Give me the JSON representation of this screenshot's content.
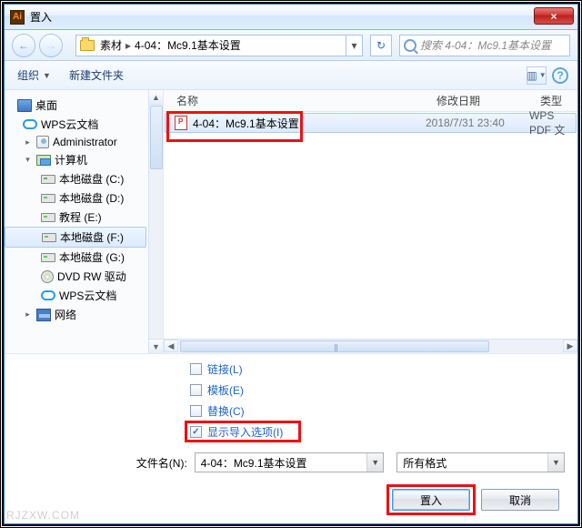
{
  "window": {
    "title": "置入",
    "close": "×"
  },
  "nav": {
    "path_segments": [
      "素材",
      "4-04：Mc9.1基本设置"
    ],
    "search_placeholder": "搜索 4-04：Mc9.1基本设置",
    "back_glyph": "←",
    "fwd_glyph": "→",
    "refresh_glyph": "↻",
    "sep": "▸",
    "drop": "▾"
  },
  "toolbar": {
    "organize": "组织",
    "newfolder": "新建文件夹",
    "drop": "▼",
    "view_glyph": "▥",
    "help": "?"
  },
  "tree": {
    "desktop": "桌面",
    "wps": "WPS云文档",
    "admin": "Administrator",
    "computer": "计算机",
    "drive_c": "本地磁盘 (C:)",
    "drive_d": "本地磁盘 (D:)",
    "drive_e": "教程 (E:)",
    "drive_f": "本地磁盘 (F:)",
    "drive_g": "本地磁盘 (G:)",
    "dvd": "DVD RW 驱动",
    "wps2": "WPS云文档",
    "network": "网络",
    "exp_open": "▾",
    "exp_closed": "▸"
  },
  "filelist": {
    "cols": {
      "name": "名称",
      "date": "修改日期",
      "type": "类型"
    },
    "row1": {
      "name": "4-04：Mc9.1基本设置",
      "date": "2018/7/31 23:40",
      "type": "WPS PDF 文"
    }
  },
  "options": {
    "link": "链接(L)",
    "template": "模板(E)",
    "replace": "替换(C)",
    "showimport": "显示导入选项(I)"
  },
  "filename": {
    "label": "文件名(N):",
    "value": "4-04：Mc9.1基本设置",
    "filter": "所有格式"
  },
  "buttons": {
    "place": "置入",
    "cancel": "取消"
  },
  "watermark": "RJZXW.COM"
}
